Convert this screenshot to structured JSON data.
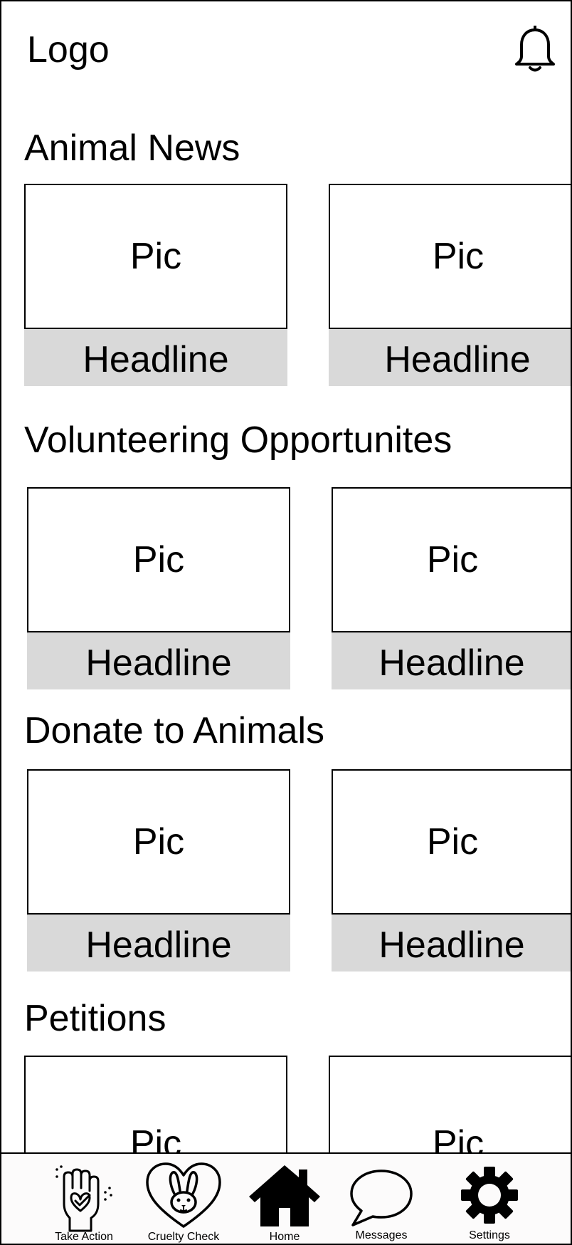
{
  "header": {
    "logo": "Logo",
    "bell_icon": "bell-icon"
  },
  "sections": [
    {
      "title": "Animal News",
      "cards": [
        {
          "pic": "Pic",
          "headline": "Headline"
        },
        {
          "pic": "Pic",
          "headline": "Headline"
        }
      ]
    },
    {
      "title": "Volunteering Opportunites",
      "cards": [
        {
          "pic": "Pic",
          "headline": "Headline"
        },
        {
          "pic": "Pic",
          "headline": "Headline"
        }
      ]
    },
    {
      "title": "Donate to Animals",
      "cards": [
        {
          "pic": "Pic",
          "headline": "Headline"
        },
        {
          "pic": "Pic",
          "headline": "Headline"
        }
      ]
    },
    {
      "title": "Petitions",
      "cards": [
        {
          "pic": "Pic"
        },
        {
          "pic": "Pic"
        }
      ]
    }
  ],
  "bottom_nav": {
    "items": [
      {
        "label": "Take Action",
        "icon": "raised-fist-heart-icon"
      },
      {
        "label": "Cruelty Check",
        "icon": "bunny-heart-icon"
      },
      {
        "label": "Home",
        "icon": "home-icon"
      },
      {
        "label": "Messages",
        "icon": "speech-bubble-icon"
      },
      {
        "label": "Settings",
        "icon": "gear-icon"
      }
    ]
  },
  "colors": {
    "headline_bg": "#d9d9d9",
    "nav_bg": "#fcfbfb",
    "border": "#000000"
  }
}
